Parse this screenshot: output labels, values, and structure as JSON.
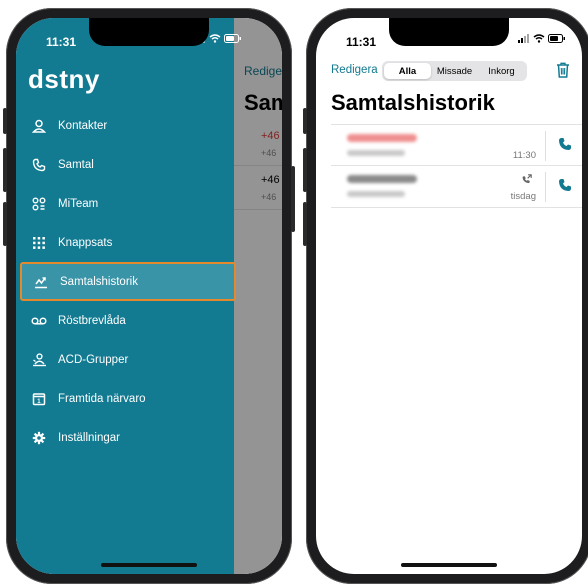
{
  "left_phone": {
    "status_time": "11:31",
    "logo": "dstny",
    "background": {
      "edit_label": "Redigera",
      "title": "Samtalshistorik",
      "rows": [
        {
          "number": "+46",
          "sub": "+46",
          "number_color": "#e03a3a"
        },
        {
          "number": "+46",
          "sub": "+46",
          "number_color": "#000000"
        }
      ]
    },
    "menu": [
      {
        "label": "Kontakter",
        "icon": "person-icon",
        "active": false
      },
      {
        "label": "Samtal",
        "icon": "phone-icon",
        "active": false
      },
      {
        "label": "MiTeam",
        "icon": "team-icon",
        "active": false
      },
      {
        "label": "Knappsats",
        "icon": "keypad-icon",
        "active": false
      },
      {
        "label": "Samtalshistorik",
        "icon": "call-history-icon",
        "active": true
      },
      {
        "label": "Röstbrevlåda",
        "icon": "voicemail-icon",
        "active": false
      },
      {
        "label": "ACD-Grupper",
        "icon": "acd-group-icon",
        "active": false
      },
      {
        "label": "Framtida närvaro",
        "icon": "calendar-icon",
        "active": false
      },
      {
        "label": "Inställningar",
        "icon": "gear-icon",
        "active": false
      }
    ]
  },
  "right_phone": {
    "status_time": "11:31",
    "edit_label": "Redigera",
    "filters": [
      "Alla",
      "Missade",
      "Inkorg"
    ],
    "active_filter": "Alla",
    "title": "Samtalshistorik",
    "calls": [
      {
        "time": "11:30",
        "missed": true,
        "outgoing": false
      },
      {
        "time": "tisdag",
        "missed": false,
        "outgoing": true
      }
    ]
  },
  "colors": {
    "brand": "#127a91",
    "highlight": "#e58a2c",
    "missed": "#e03a3a"
  }
}
